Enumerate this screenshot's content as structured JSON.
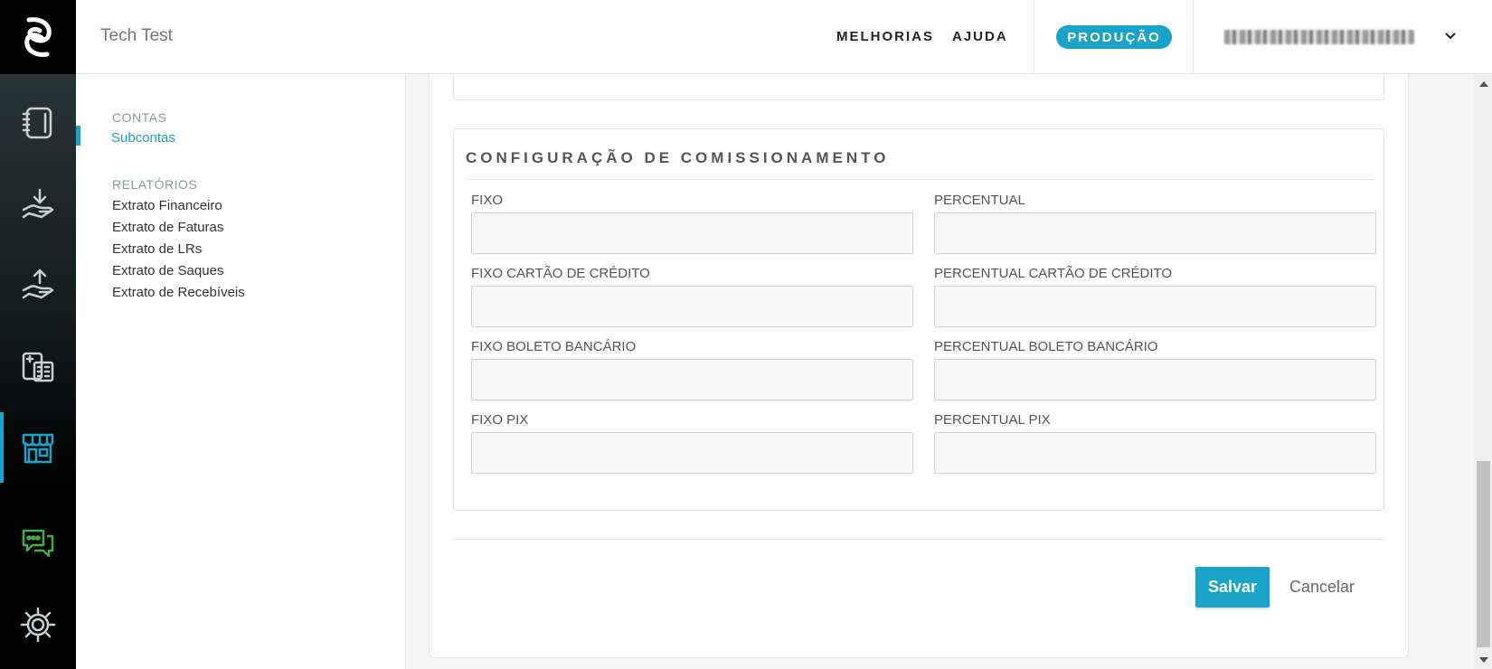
{
  "header": {
    "app_title": "Tech Test",
    "nav": [
      {
        "label": "MELHORIAS"
      },
      {
        "label": "AJUDA"
      }
    ],
    "environment_badge": "PRODUÇÃO",
    "user_menu": {
      "caret_icon": "chevron-down-icon"
    }
  },
  "rail": {
    "items": [
      {
        "icon": "notebook-icon",
        "active": false
      },
      {
        "icon": "hand-receive-icon",
        "active": false
      },
      {
        "icon": "hand-send-icon",
        "active": false
      },
      {
        "icon": "calculator-icon",
        "active": false
      },
      {
        "icon": "store-icon",
        "active": true
      },
      {
        "icon": "chat-bubbles-icon",
        "active": false
      },
      {
        "icon": "gear-icon",
        "active": false
      }
    ],
    "colors": {
      "active": "#1aa3c8",
      "chat": "#3fae49",
      "default": "#c8d0d2"
    }
  },
  "sidebar": {
    "sections": [
      {
        "heading": "CONTAS",
        "items": [
          "Subcontas"
        ]
      },
      {
        "heading": "RELATÓRIOS",
        "items": [
          "Extrato Financeiro",
          "Extrato de Faturas",
          "Extrato de LRs",
          "Extrato de Saques",
          "Extrato de Recebíveis"
        ]
      }
    ],
    "active_item": "Subcontas"
  },
  "form": {
    "panel_title": "CONFIGURAÇÃO DE COMISSIONAMENTO",
    "fields": [
      {
        "label": "FIXO",
        "value": ""
      },
      {
        "label": "PERCENTUAL",
        "value": ""
      },
      {
        "label": "FIXO CARTÃO DE CRÉDITO",
        "value": ""
      },
      {
        "label": "PERCENTUAL CARTÃO DE CRÉDITO",
        "value": ""
      },
      {
        "label": "FIXO BOLETO BANCÁRIO",
        "value": ""
      },
      {
        "label": "PERCENTUAL BOLETO BANCÁRIO",
        "value": ""
      },
      {
        "label": "FIXO PIX",
        "value": ""
      },
      {
        "label": "PERCENTUAL PIX",
        "value": ""
      }
    ],
    "save_label": "Salvar",
    "cancel_label": "Cancelar"
  },
  "colors": {
    "accent": "#1aa3c8"
  }
}
